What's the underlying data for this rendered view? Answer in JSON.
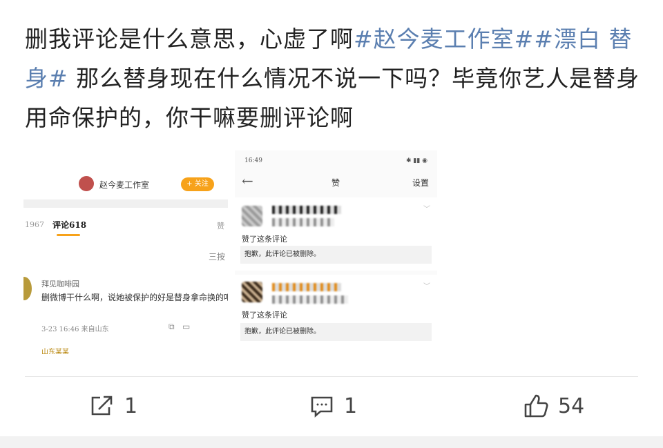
{
  "post": {
    "text_part1": "删我评论是什么意思，心虚了啊",
    "tag1": "#赵今麦工作室#",
    "tag2": "#漂白 替身#",
    "text_part2": " 那么替身现在什么情况不说一下吗？毕竟你艺人是替身用命保护的，你干嘛要删评论啊"
  },
  "left_shot": {
    "studio_name": "赵今麦工作室",
    "follow_label": "+ 关注",
    "tab_forward": "1967",
    "tab_comments": "评论618",
    "tab_like": "赞",
    "sort_label": "三按",
    "comment": {
      "user": "拜见咖啡园",
      "text": "删微博干什么啊，说她被保护的好是替身拿命换的吧",
      "meta": "3-23 16:46 来自山东",
      "next_user": "山东某某"
    }
  },
  "right_shot": {
    "status_time": "16:49",
    "status_icons": "✱ ▮▮ ◉",
    "back_icon": "←",
    "title": "赞",
    "settings": "设置",
    "items": [
      {
        "liked": "赞了这条评论",
        "deleted": "抱歉，此评论已被删除。"
      },
      {
        "liked": "赞了这条评论",
        "deleted": "抱歉，此评论已被删除。"
      }
    ]
  },
  "actions": {
    "repost_count": "1",
    "comment_count": "1",
    "like_count": "54"
  },
  "icons": {
    "repost": "share-icon",
    "comment": "comment-icon",
    "like": "thumbs-up-icon"
  },
  "colors": {
    "tag": "#5b7fb0",
    "follow": "#f7a21a"
  }
}
